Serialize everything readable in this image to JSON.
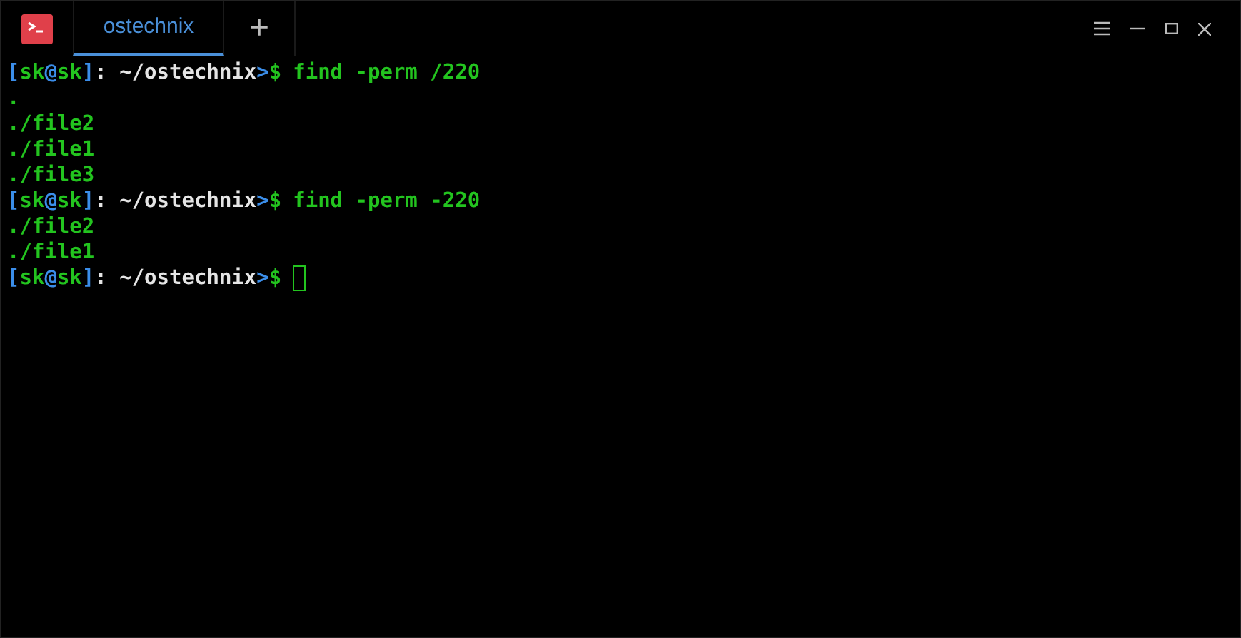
{
  "tabs": [
    {
      "label": "ostechnix",
      "selected": true
    }
  ],
  "new_tab": "+",
  "lines": [
    {
      "kind": "prompt",
      "segments": [
        {
          "text": "[",
          "color": "#3b8eea"
        },
        {
          "text": "sk",
          "color": "#23c41f"
        },
        {
          "text": "@",
          "color": "#3b8eea"
        },
        {
          "text": "sk",
          "color": "#23c41f"
        },
        {
          "text": "]",
          "color": "#3b8eea"
        },
        {
          "text": ": ~/ostechnix",
          "color": "#e5e5e5"
        },
        {
          "text": ">",
          "color": "#3b8eea"
        },
        {
          "text": "$",
          "color": "#23c41f"
        }
      ],
      "command": "find -perm /220",
      "cursor": false
    },
    {
      "kind": "output",
      "text": "."
    },
    {
      "kind": "output",
      "text": "./file2"
    },
    {
      "kind": "output",
      "text": "./file1"
    },
    {
      "kind": "output",
      "text": "./file3"
    },
    {
      "kind": "prompt",
      "segments": [
        {
          "text": "[",
          "color": "#3b8eea"
        },
        {
          "text": "sk",
          "color": "#23c41f"
        },
        {
          "text": "@",
          "color": "#3b8eea"
        },
        {
          "text": "sk",
          "color": "#23c41f"
        },
        {
          "text": "]",
          "color": "#3b8eea"
        },
        {
          "text": ": ~/ostechnix",
          "color": "#e5e5e5"
        },
        {
          "text": ">",
          "color": "#3b8eea"
        },
        {
          "text": "$",
          "color": "#23c41f"
        }
      ],
      "command": "find -perm -220",
      "cursor": false
    },
    {
      "kind": "output",
      "text": "./file2"
    },
    {
      "kind": "output",
      "text": "./file1"
    },
    {
      "kind": "prompt",
      "segments": [
        {
          "text": "[",
          "color": "#3b8eea"
        },
        {
          "text": "sk",
          "color": "#23c41f"
        },
        {
          "text": "@",
          "color": "#3b8eea"
        },
        {
          "text": "sk",
          "color": "#23c41f"
        },
        {
          "text": "]",
          "color": "#3b8eea"
        },
        {
          "text": ": ~/ostechnix",
          "color": "#e5e5e5"
        },
        {
          "text": ">",
          "color": "#3b8eea"
        },
        {
          "text": "$",
          "color": "#23c41f"
        }
      ],
      "cursor": true
    }
  ]
}
